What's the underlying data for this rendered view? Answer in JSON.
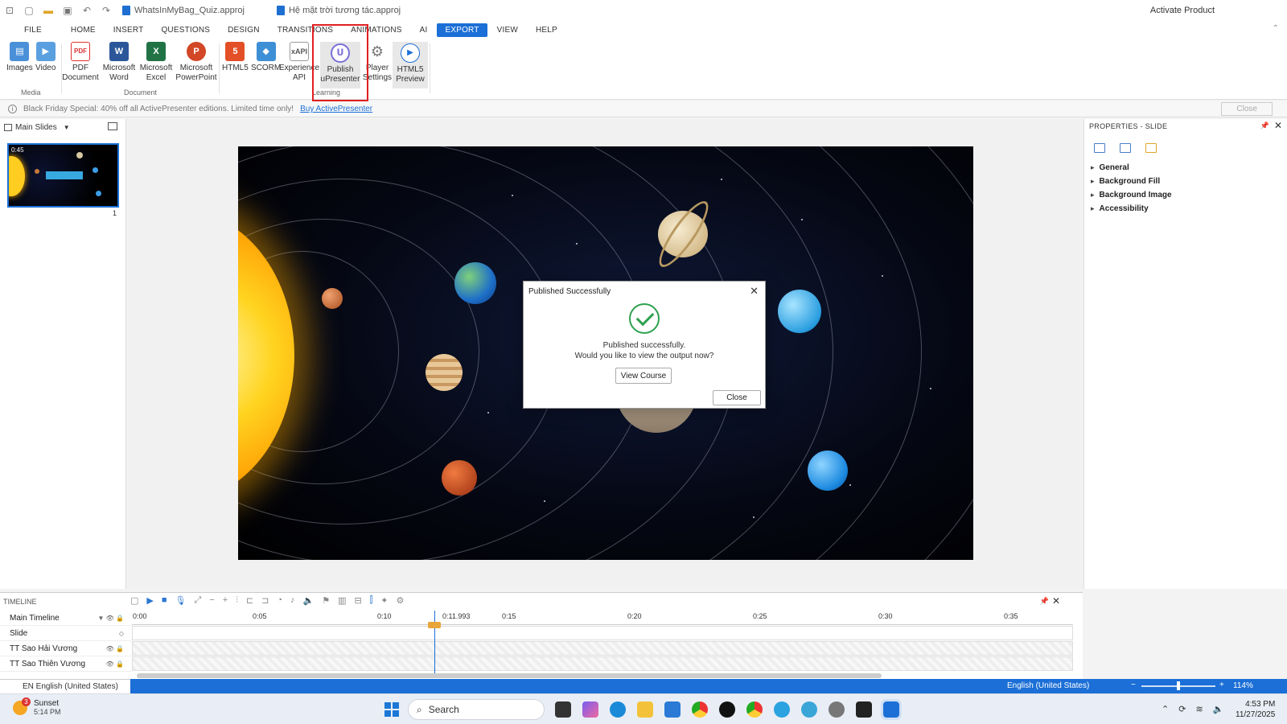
{
  "window": {
    "doc_tabs": [
      "WhatsInMyBag_Quiz.approj",
      "Hệ mặt trời tương tác.approj"
    ],
    "activate": "Activate Product"
  },
  "menu": [
    "FILE",
    "HOME",
    "INSERT",
    "QUESTIONS",
    "DESIGN",
    "TRANSITIONS",
    "ANIMATIONS",
    "AI",
    "EXPORT",
    "VIEW",
    "HELP"
  ],
  "active_menu": "EXPORT",
  "ribbon": {
    "buttons": [
      {
        "label": "Images",
        "icon": "images-icon"
      },
      {
        "label": "Video",
        "icon": "video-icon"
      },
      {
        "label": "PDF\nDocument",
        "icon": "pdf-icon"
      },
      {
        "label": "Microsoft\nWord",
        "icon": "word-icon"
      },
      {
        "label": "Microsoft\nExcel",
        "icon": "excel-icon"
      },
      {
        "label": "Microsoft\nPowerPoint",
        "icon": "powerpoint-icon"
      },
      {
        "label": "HTML5",
        "icon": "html5-icon"
      },
      {
        "label": "SCORM",
        "icon": "scorm-icon"
      },
      {
        "label": "Experience\nAPI",
        "icon": "xapi-icon"
      },
      {
        "label": "Publish\nuPresenter",
        "icon": "upresenter-icon"
      },
      {
        "label": "Player\nSettings",
        "icon": "gear-icon"
      },
      {
        "label": "HTML5\nPreview",
        "icon": "play-icon"
      }
    ],
    "groups": [
      "Media",
      "Document",
      "Learning"
    ]
  },
  "promo": {
    "text": "Black Friday Special: 40% off all ActivePresenter editions. Limited time only!",
    "link": "Buy ActivePresenter",
    "close": "Close"
  },
  "slides_panel": {
    "title": "Main Slides",
    "thumb_time": "0:45",
    "slide_number": "1"
  },
  "dialog": {
    "title": "Published Successfully",
    "line1": "Published successfully.",
    "line2": "Would you like to view the output now?",
    "view_button": "View Course",
    "close_button": "Close"
  },
  "properties": {
    "title": "PROPERTIES - SLIDE",
    "sections": [
      "General",
      "Background Fill",
      "Background Image",
      "Accessibility"
    ]
  },
  "timeline": {
    "title": "TIMELINE",
    "rows": [
      "Main Timeline",
      "Slide",
      "TT Sao Hải Vương",
      "TT Sao Thiên Vương"
    ],
    "ticks": [
      "0:00",
      "0:05",
      "0:10",
      "0:15",
      "0:20",
      "0:25",
      "0:30",
      "0:35"
    ],
    "playhead": "0:11.993"
  },
  "status": {
    "lang_left": "EN English (United States)",
    "lang_right": "English (United States)",
    "zoom": "114%"
  },
  "taskbar": {
    "weather_title": "Sunset",
    "weather_time": "5:14 PM",
    "weather_badge": "3",
    "search": "Search",
    "time": "4:53 PM",
    "date": "11/27/2025"
  },
  "colors": {
    "accent": "#1b6fd6",
    "highlight": "#e02020",
    "success": "#2ea14f"
  }
}
